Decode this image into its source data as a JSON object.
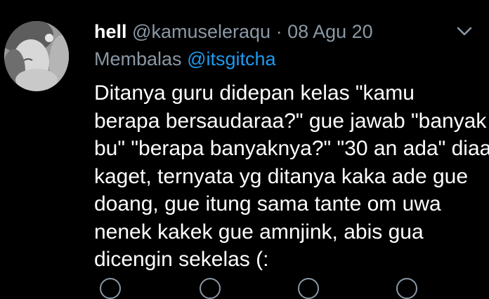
{
  "tweet": {
    "display_name": "hell",
    "handle": "@kamuseleraqu",
    "separator": "·",
    "date": "08 Agu 20",
    "reply_prefix": "Membalas",
    "reply_mention": "@itsgitcha",
    "text_lines": [
      "Ditanya guru didepan kelas \"kamu",
      "berapa bersaudaraa?\" gue jawab \"banyak",
      "bu\" \"berapa banyaknya?\" \"30 an ada\" diaa",
      "kaget, ternyata yg ditanya kaka ade gue",
      "doang, gue itung sama tante om uwa",
      "nenek kakek gue amnjink, abis gua",
      "dicengin sekelas (:"
    ]
  },
  "icons": {
    "avatar": "user-avatar",
    "menu": "chevron-down-icon",
    "actions": [
      "reply-icon",
      "retweet-icon",
      "like-icon",
      "share-icon"
    ]
  },
  "colors": {
    "background": "#000000",
    "text": "#ffffff",
    "secondary": "#8b98a5",
    "link": "#1d9bf0"
  }
}
